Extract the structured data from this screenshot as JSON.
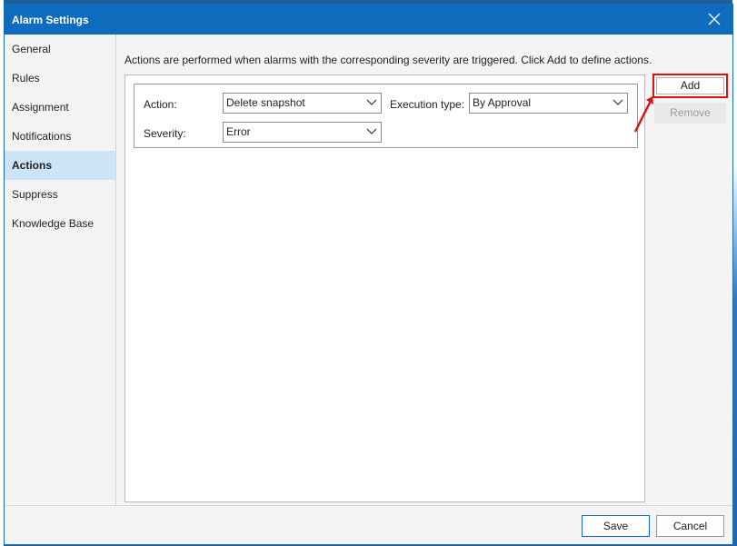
{
  "window": {
    "title": "Alarm Settings",
    "close_icon": "close-icon"
  },
  "sidebar": {
    "items": [
      {
        "label": "General"
      },
      {
        "label": "Rules"
      },
      {
        "label": "Assignment"
      },
      {
        "label": "Notifications"
      },
      {
        "label": "Actions",
        "selected": true
      },
      {
        "label": "Suppress"
      },
      {
        "label": "Knowledge Base"
      }
    ]
  },
  "main": {
    "description": "Actions are performed when alarms with the corresponding severity are triggered. Click Add to define actions.",
    "action_entry": {
      "action_label": "Action:",
      "action_value": "Delete snapshot",
      "execution_type_label": "Execution type:",
      "execution_type_value": "By Approval",
      "severity_label": "Severity:",
      "severity_value": "Error"
    },
    "buttons": {
      "add": "Add",
      "remove": "Remove"
    }
  },
  "footer": {
    "save": "Save",
    "cancel": "Cancel"
  },
  "colors": {
    "titlebar": "#0f6cbd",
    "selected_item": "#cce4f7",
    "highlight": "#e01010"
  }
}
